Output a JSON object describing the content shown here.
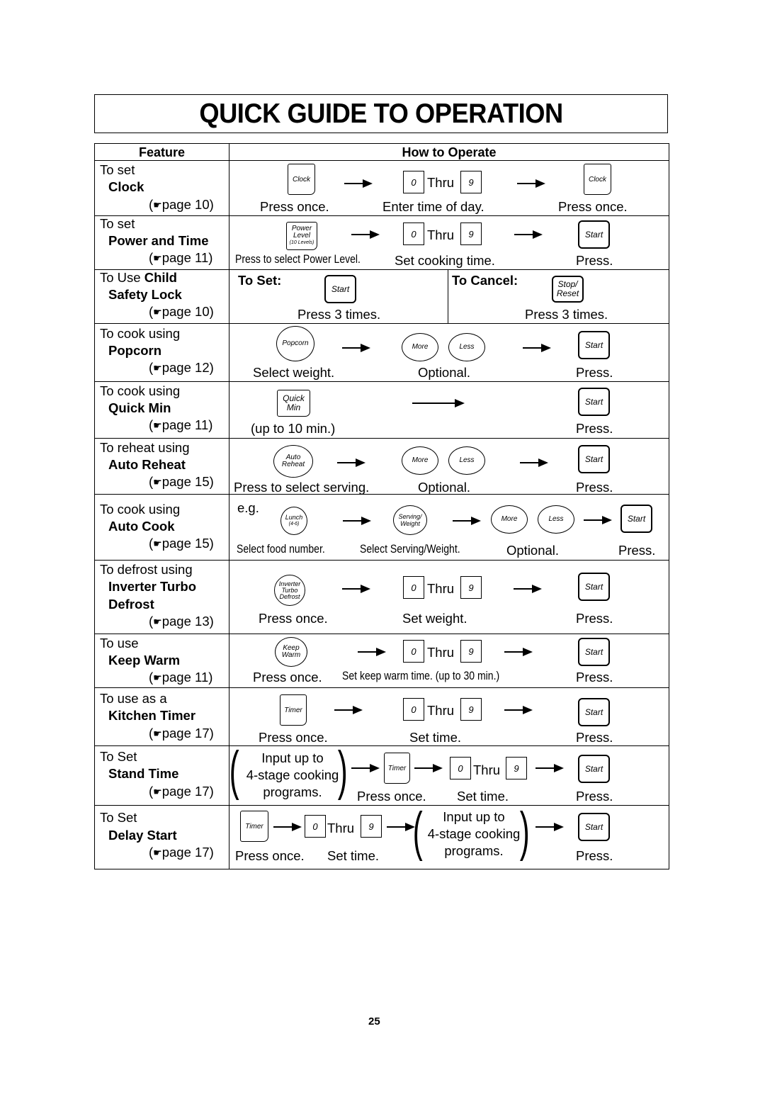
{
  "title": "QUICK GUIDE TO OPERATION",
  "page_number": "25",
  "header": {
    "feature": "Feature",
    "how_to_operate": "How to Operate"
  },
  "common": {
    "thru": "Thru",
    "digit_first": "0",
    "digit_last": "9",
    "start_key": "Start",
    "more_key": "More",
    "less_key": "Less",
    "timer_key": "Timer",
    "hand_icon": "☛"
  },
  "rows": [
    {
      "intro": "To set",
      "feature": "Clock",
      "page": "page 10)",
      "keys": {
        "first": "Clock",
        "last": "Clock"
      },
      "captions": [
        "Press once.",
        "Enter time of day.",
        "Press once."
      ]
    },
    {
      "intro": "To set",
      "feature": "Power and Time",
      "page": "page 11)",
      "keys": {
        "first_l1": "Power",
        "first_l2": "Level",
        "first_l3": "(10 Levels)"
      },
      "captions": [
        "Press to select Power Level.",
        "Set cooking time.",
        "Press."
      ]
    },
    {
      "intro": "To Use ",
      "feature_inline": "Child",
      "feature": "Safety Lock",
      "page": "page 10)",
      "to_set": "To Set:",
      "to_cancel": "To Cancel:",
      "keys": {
        "cancel_l1": "Stop/",
        "cancel_l2": "Reset"
      },
      "captions": [
        "Press 3 times.",
        "Press 3 times."
      ]
    },
    {
      "intro": "To cook using",
      "feature": "Popcorn",
      "page": "page 12)",
      "keys": {
        "first": "Popcorn"
      },
      "captions": [
        "Select weight.",
        "Optional.",
        "Press."
      ]
    },
    {
      "intro": "To cook using",
      "feature": "Quick Min",
      "page": "page 11)",
      "keys": {
        "first_l1": "Quick",
        "first_l2": "Min"
      },
      "captions": [
        "(up to 10 min.)",
        "Press."
      ]
    },
    {
      "intro": "To reheat using",
      "feature": "Auto Reheat",
      "page": "page 15)",
      "keys": {
        "first_l1": "Auto",
        "first_l2": "Reheat"
      },
      "captions": [
        "Press to select serving.",
        "Optional.",
        "Press."
      ]
    },
    {
      "intro": "To cook using",
      "feature": "Auto Cook",
      "page": "page 15)",
      "eg": "e.g.",
      "keys": {
        "first_l1": "Lunch",
        "first_l2": "(4-6)",
        "second_l1": "Serving/",
        "second_l2": "Weight"
      },
      "captions": [
        "Select food number.",
        "Select Serving/Weight.",
        "Optional.",
        "Press."
      ]
    },
    {
      "intro": "To defrost using",
      "feature": "Inverter Turbo",
      "feature_l2": "Defrost",
      "page": "page 13)",
      "keys": {
        "first_l1": "Inverter",
        "first_l2": "Turbo",
        "first_l3": "Defrost"
      },
      "captions": [
        "Press once.",
        "Set weight.",
        "Press."
      ]
    },
    {
      "intro": "To use",
      "feature": "Keep Warm",
      "page": "page 11)",
      "keys": {
        "first_l1": "Keep",
        "first_l2": "Warm"
      },
      "captions": [
        "Press once.",
        "Set keep warm time. (up to 30 min.)",
        "Press."
      ]
    },
    {
      "intro": "To use as a",
      "feature": "Kitchen Timer",
      "page": "page 17)",
      "captions": [
        "Press once.",
        "Set time.",
        "Press."
      ]
    },
    {
      "intro": "To Set",
      "feature": "Stand Time",
      "page": "page 17)",
      "program_l1": "Input up to",
      "program_l2": "4-stage cooking",
      "program_l3": "programs.",
      "captions": [
        "Press once.",
        "Set time.",
        "Press."
      ]
    },
    {
      "intro": "To Set",
      "feature": "Delay Start",
      "page": "page 17)",
      "program_l1": "Input up to",
      "program_l2": "4-stage cooking",
      "program_l3": "programs.",
      "captions": [
        "Press once.",
        "Set time.",
        "Press."
      ]
    }
  ]
}
